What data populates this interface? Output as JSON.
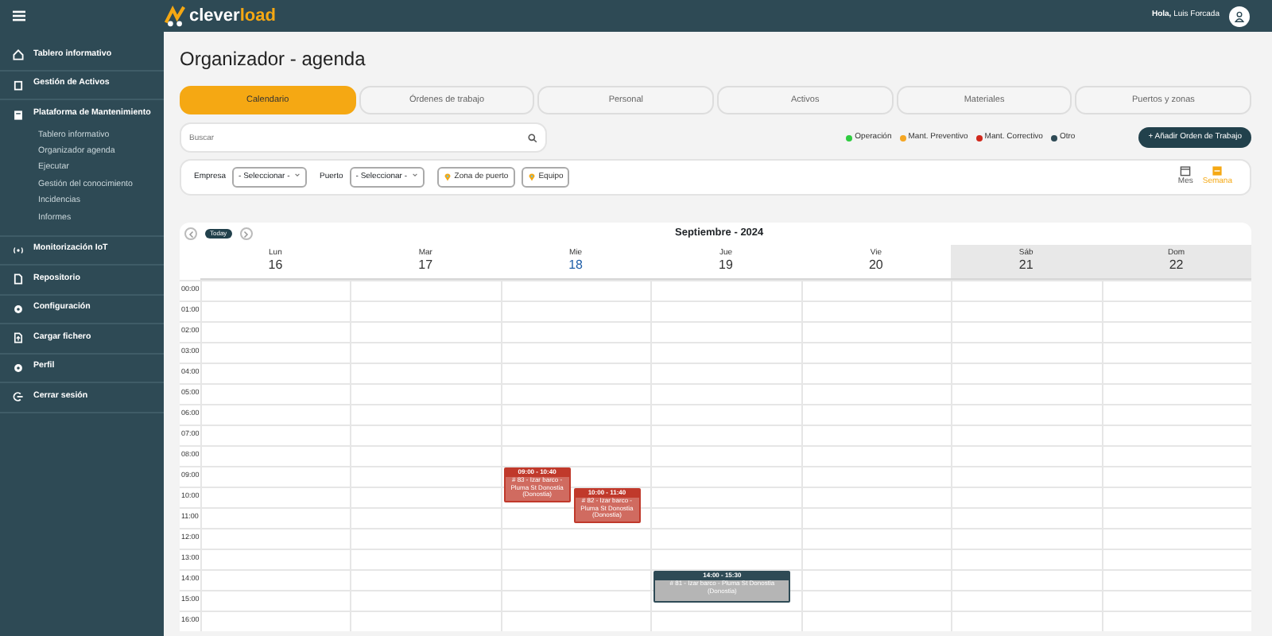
{
  "topbar": {
    "logo_text_1": "clever",
    "logo_text_2": "load",
    "greeting_bold": "Hola,",
    "user_name": "Luis Forcada"
  },
  "sidebar": {
    "items": [
      {
        "label": "Tablero informativo",
        "expanded": false
      },
      {
        "label": "Gestión de Activos",
        "expanded": false
      },
      {
        "label": "Plataforma de Mantenimiento",
        "expanded": true,
        "children": [
          {
            "label": "Tablero informativo"
          },
          {
            "label": "Organizador agenda"
          },
          {
            "label": "Ejecutar"
          },
          {
            "label": "Gestión del conocimiento"
          },
          {
            "label": "Incidencias"
          },
          {
            "label": "Informes"
          }
        ]
      },
      {
        "label": "Monitorización IoT",
        "expanded": false
      },
      {
        "label": "Repositorio",
        "expanded": false
      },
      {
        "label": "Configuración",
        "expanded": false
      },
      {
        "label": "Cargar fichero",
        "expanded": false
      },
      {
        "label": "Perfil",
        "expanded": false
      },
      {
        "label": "Cerrar sesión",
        "expanded": false
      }
    ]
  },
  "page_title": "Organizador - agenda",
  "tabs": [
    {
      "label": "Calendario",
      "selected": true
    },
    {
      "label": "Órdenes de trabajo",
      "selected": false
    },
    {
      "label": "Personal",
      "selected": false
    },
    {
      "label": "Activos",
      "selected": false
    },
    {
      "label": "Materiales",
      "selected": false
    },
    {
      "label": "Puertos y zonas",
      "selected": false
    }
  ],
  "search": {
    "placeholder": "Buscar"
  },
  "legend": [
    {
      "label": "Operación",
      "color": "#2ecc40"
    },
    {
      "label": "Mant. Preventivo",
      "color": "#f5a623"
    },
    {
      "label": "Mant. Correctivo",
      "color": "#d0281c"
    },
    {
      "label": "Otro",
      "color": "#2e4a55"
    }
  ],
  "add_button": "+ Añadir Orden de Trabajo",
  "filters": {
    "empresa_label": "Empresa",
    "empresa_value": "- Seleccionar -",
    "puerto_label": "Puerto",
    "puerto_value": "- Seleccionar -",
    "chips": [
      "Zona de puerto",
      "Equipo"
    ]
  },
  "views": [
    {
      "label": "Mes",
      "selected": false
    },
    {
      "label": "Semana",
      "selected": true
    }
  ],
  "calendar": {
    "today_button": "Today",
    "title": "Septiembre - 2024",
    "days": [
      {
        "name": "Lun",
        "date": "16",
        "today": false,
        "weekend": false
      },
      {
        "name": "Mar",
        "date": "17",
        "today": false,
        "weekend": false
      },
      {
        "name": "Mie",
        "date": "18",
        "today": true,
        "weekend": false,
        "events": [
          {
            "time": "09:00 - 10:40",
            "text": "# 83 - Izar barco - Pluma St Donostia (Donostia)",
            "color": "#c0392b"
          },
          {
            "time": "10:00 - 11:40",
            "text": "# 82 - Izar barco - Pluma St Donostia (Donostia)",
            "color": "#c0392b"
          }
        ]
      },
      {
        "name": "Jue",
        "date": "19",
        "today": false,
        "weekend": false,
        "events": [
          {
            "time": "14:00 - 15:30",
            "text": "# 81 - Izar barco - Pluma St Donostia (Donostia)",
            "color": "#2e4a55"
          }
        ]
      },
      {
        "name": "Vie",
        "date": "20",
        "today": false,
        "weekend": false
      },
      {
        "name": "Sáb",
        "date": "21",
        "today": false,
        "weekend": true
      },
      {
        "name": "Dom",
        "date": "22",
        "today": false,
        "weekend": true
      }
    ],
    "hours": [
      "00:00",
      "01:00",
      "02:00",
      "03:00",
      "04:00",
      "05:00",
      "06:00",
      "07:00",
      "08:00",
      "09:00",
      "10:00",
      "11:00",
      "12:00",
      "13:00",
      "14:00",
      "15:00",
      "16:00"
    ]
  }
}
